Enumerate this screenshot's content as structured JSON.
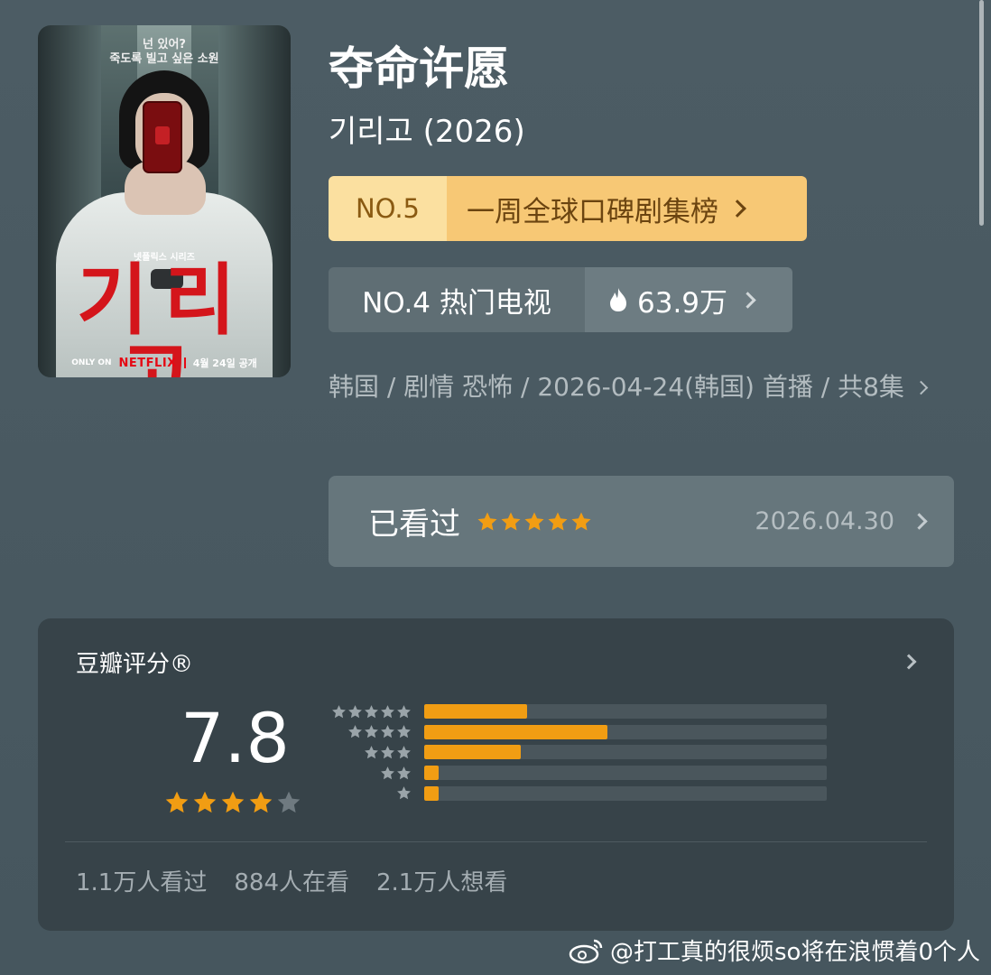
{
  "poster": {
    "tagline_1": "넌 있어?",
    "tagline_2": "죽도록 빌고 싶은 소원",
    "series_label": "넷플릭스 시리즈",
    "korean_title": "기리고",
    "only_on": "ONLY ON",
    "netflix": "NETFLIX",
    "release": "4월 24일 공개"
  },
  "title": "夺命许愿",
  "original_title": "기리고 (2026)",
  "rank_badge_1": {
    "number": "NO.5",
    "label": "一周全球口碑剧集榜"
  },
  "rank_badge_2": {
    "label": "NO.4 热门电视",
    "heat": "63.9万"
  },
  "meta": {
    "line": "韩国 / 剧情 恐怖 / 2026-04-24(韩国) 首播 / 共8集"
  },
  "watched": {
    "label": "已看过",
    "stars": 5,
    "date": "2026.04.30"
  },
  "rating": {
    "heading": "豆瓣评分®",
    "score": "7.8",
    "stars": 4,
    "distribution": [
      {
        "stars": 5,
        "fraction": 0.255
      },
      {
        "stars": 4,
        "fraction": 0.455
      },
      {
        "stars": 3,
        "fraction": 0.24
      },
      {
        "stars": 2,
        "fraction": 0.035
      },
      {
        "stars": 1,
        "fraction": 0.03
      }
    ],
    "stats": [
      "1.1万人看过",
      "884人在看",
      "2.1万人想看"
    ]
  },
  "watermark": "@打工真的很烦so将在浪惯着0个人",
  "colors": {
    "gold": "#f19d13",
    "badge_gold": "#f7c875",
    "card_bg": "#374349"
  }
}
